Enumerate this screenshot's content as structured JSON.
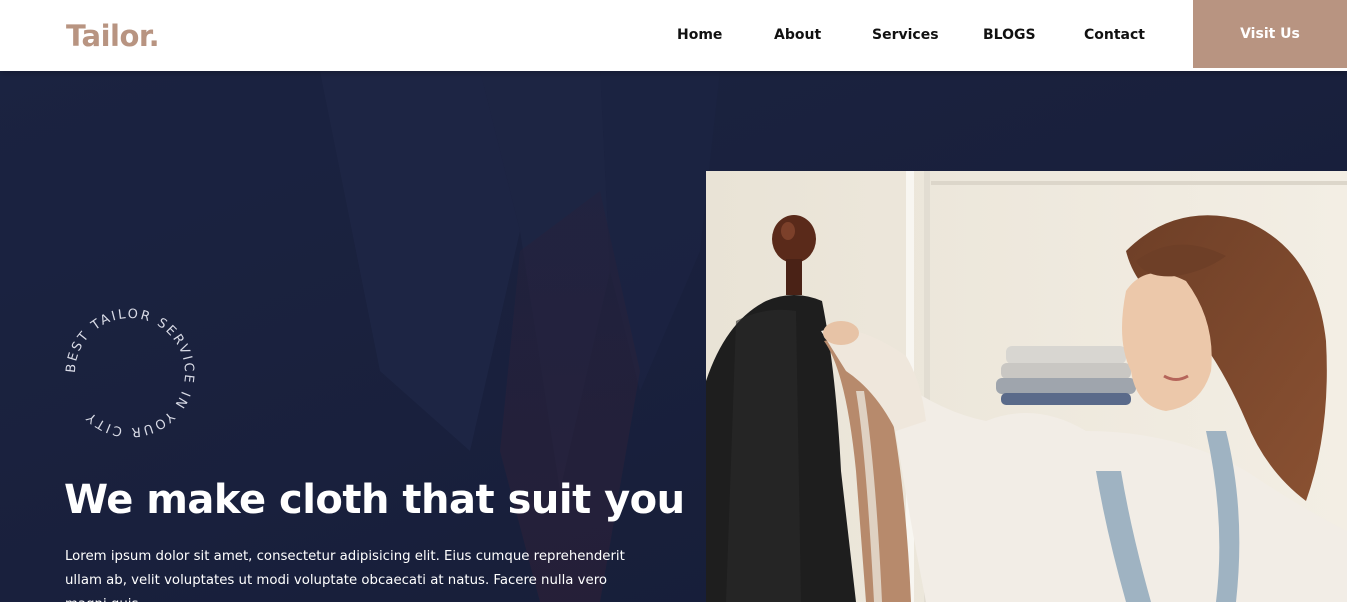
{
  "brand": {
    "name": "Tailor.",
    "accent_color": "#b89481"
  },
  "nav": {
    "items": [
      {
        "label": "Home"
      },
      {
        "label": "About"
      },
      {
        "label": "Services"
      },
      {
        "label": "BLOGS"
      },
      {
        "label": "Contact"
      }
    ],
    "cta_label": "Visit Us"
  },
  "hero": {
    "badge_text": "BEST TAILOR SERVICE IN YOUR CITY ",
    "headline": "We make cloth that suit you",
    "lead": "Lorem ipsum dolor sit amet, consectetur adipisicing elit. Eius cumque reprehenderit ullam ab, velit voluptates ut modi voluptate obcaecati at natus. Facere nulla vero magni quis",
    "background_color": "#1b2240",
    "photo_icon": "tailor-with-mannequin-photo"
  }
}
